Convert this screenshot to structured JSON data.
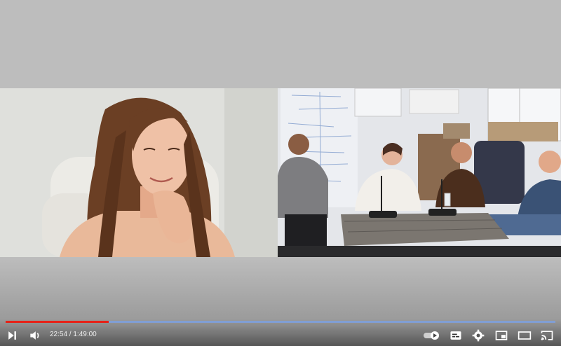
{
  "player": {
    "time": {
      "current": "22:54",
      "separator": " / ",
      "duration": "1:49:00"
    },
    "progress": {
      "played_fraction": 0.187,
      "loaded_fraction": 1.0
    },
    "colors": {
      "played": "#e62117",
      "loaded": "#6e96dc",
      "background": "#bdbdbd"
    },
    "controls": {
      "next": "next-icon",
      "volume": "volume-icon",
      "autoplay": "autoplay-toggle-icon",
      "subtitles": "subtitles-icon",
      "settings": "gear-icon",
      "miniplayer": "miniplayer-icon",
      "theater": "theater-icon",
      "cast": "cast-icon"
    }
  }
}
